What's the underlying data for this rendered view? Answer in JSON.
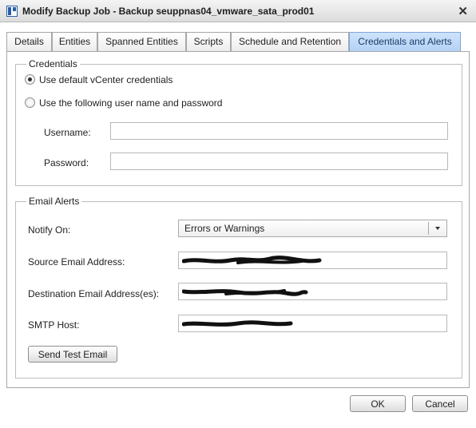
{
  "window": {
    "title": "Modify Backup Job - Backup seuppnas04_vmware_sata_prod01",
    "close_glyph": "✕"
  },
  "tabs": [
    {
      "label": "Details",
      "active": false
    },
    {
      "label": "Entities",
      "active": false
    },
    {
      "label": "Spanned Entities",
      "active": false
    },
    {
      "label": "Scripts",
      "active": false
    },
    {
      "label": "Schedule and Retention",
      "active": false
    },
    {
      "label": "Credentials and Alerts",
      "active": true
    }
  ],
  "credentials": {
    "legend": "Credentials",
    "option_default": "Use default vCenter credentials",
    "option_custom": "Use the following user name and password",
    "selected": "default",
    "username_label": "Username:",
    "username_value": "",
    "password_label": "Password:",
    "password_value": ""
  },
  "email_alerts": {
    "legend": "Email Alerts",
    "notify_on_label": "Notify On:",
    "notify_on_value": "Errors or Warnings",
    "source_label": "Source Email Address:",
    "destination_label": "Destination Email Address(es):",
    "smtp_label": "SMTP Host:",
    "send_test_label": "Send Test Email"
  },
  "footer": {
    "ok_label": "OK",
    "cancel_label": "Cancel"
  },
  "icons": {
    "app": "app-window-icon",
    "close": "close-icon",
    "dropdown": "chevron-down-icon"
  }
}
